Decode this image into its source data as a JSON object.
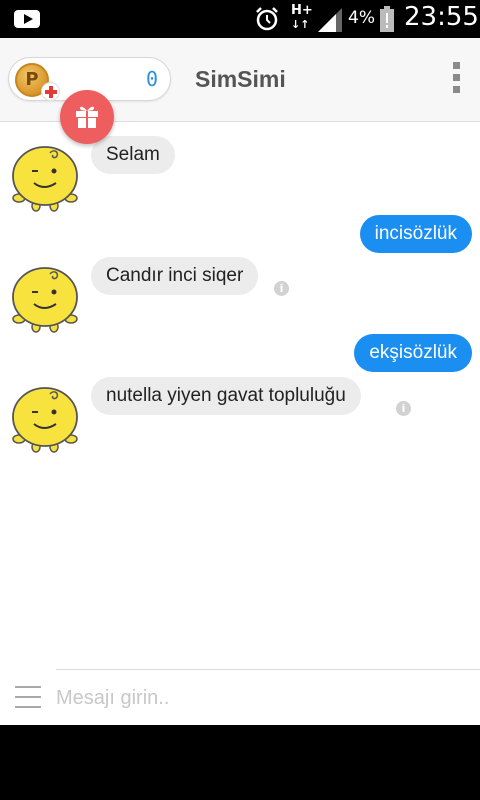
{
  "status_bar": {
    "youtube_icon": "youtube-icon",
    "alarm_icon": "alarm-clock-icon",
    "network_type": "H+",
    "signal_icon": "signal-bars-icon",
    "battery_percent": "4%",
    "battery_icon": "battery-low-icon",
    "time": "23:55"
  },
  "app_bar": {
    "points_icon": "coin-p-icon",
    "add_points_icon": "red-plus-icon",
    "points_value": "0",
    "gift_icon": "gift-icon",
    "title": "SimSimi",
    "menu_icon": "more-vertical-icon"
  },
  "messages": [
    {
      "from": "bot",
      "text": "Selam",
      "info_icon": false
    },
    {
      "from": "user",
      "text": "incisözlük"
    },
    {
      "from": "bot",
      "text": "Candır inci siqer",
      "info_icon": true
    },
    {
      "from": "user",
      "text": "ekşisözlük"
    },
    {
      "from": "bot",
      "text": "nutella yiyen gavat topluluğu",
      "info_icon": true
    }
  ],
  "input_bar": {
    "menu_icon": "hamburger-menu-icon",
    "placeholder": "Mesajı girin.."
  },
  "colors": {
    "user_bubble": "#1b8ef2",
    "bot_bubble": "#ececec",
    "gift_button": "#ef5e5e",
    "points_value": "#2f8fd8"
  }
}
